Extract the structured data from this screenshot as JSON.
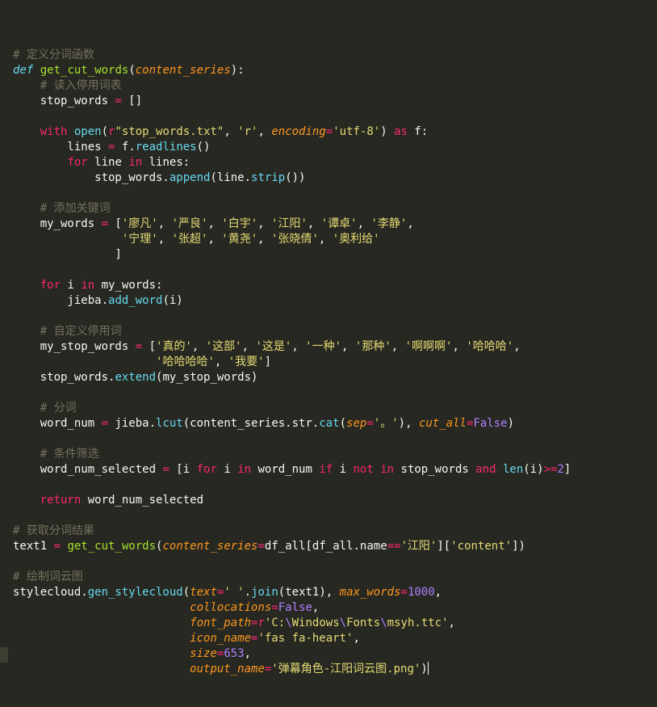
{
  "editor": {
    "lines": [
      [],
      [
        [
          "c-com",
          "# 定义分词函数"
        ]
      ],
      [
        [
          "c-def",
          "def"
        ],
        [
          "c-txt",
          " "
        ],
        [
          "c-fn",
          "get_cut_words"
        ],
        [
          "c-txt",
          "("
        ],
        [
          "c-prm",
          "content_series"
        ],
        [
          "c-txt",
          "):"
        ]
      ],
      [
        [
          "c-txt",
          "    "
        ],
        [
          "c-com",
          "# 读入停用词表"
        ]
      ],
      [
        [
          "c-txt",
          "    stop_words "
        ],
        [
          "c-kw",
          "="
        ],
        [
          "c-txt",
          " []"
        ]
      ],
      [],
      [
        [
          "c-txt",
          "    "
        ],
        [
          "c-kw",
          "with"
        ],
        [
          "c-txt",
          " "
        ],
        [
          "c-bi",
          "open"
        ],
        [
          "c-txt",
          "("
        ],
        [
          "c-kw",
          "r"
        ],
        [
          "c-str",
          "\"stop_words.txt\""
        ],
        [
          "c-txt",
          ", "
        ],
        [
          "c-str",
          "'r'"
        ],
        [
          "c-txt",
          ", "
        ],
        [
          "c-prm",
          "encoding"
        ],
        [
          "c-kw",
          "="
        ],
        [
          "c-str",
          "'utf-8'"
        ],
        [
          "c-txt",
          ") "
        ],
        [
          "c-kw",
          "as"
        ],
        [
          "c-txt",
          " f:"
        ]
      ],
      [
        [
          "c-txt",
          "        lines "
        ],
        [
          "c-kw",
          "="
        ],
        [
          "c-txt",
          " f."
        ],
        [
          "c-bi",
          "readlines"
        ],
        [
          "c-txt",
          "()"
        ]
      ],
      [
        [
          "c-txt",
          "        "
        ],
        [
          "c-kw",
          "for"
        ],
        [
          "c-txt",
          " line "
        ],
        [
          "c-kw",
          "in"
        ],
        [
          "c-txt",
          " lines:"
        ]
      ],
      [
        [
          "c-txt",
          "            stop_words."
        ],
        [
          "c-bi",
          "append"
        ],
        [
          "c-txt",
          "(line."
        ],
        [
          "c-bi",
          "strip"
        ],
        [
          "c-txt",
          "())"
        ]
      ],
      [],
      [
        [
          "c-txt",
          "    "
        ],
        [
          "c-com",
          "# 添加关键词"
        ]
      ],
      [
        [
          "c-txt",
          "    my_words "
        ],
        [
          "c-kw",
          "="
        ],
        [
          "c-txt",
          " ["
        ],
        [
          "c-str",
          "'廖凡'"
        ],
        [
          "c-txt",
          ", "
        ],
        [
          "c-str",
          "'严良'"
        ],
        [
          "c-txt",
          ", "
        ],
        [
          "c-str",
          "'白宇'"
        ],
        [
          "c-txt",
          ", "
        ],
        [
          "c-str",
          "'江阳'"
        ],
        [
          "c-txt",
          ", "
        ],
        [
          "c-str",
          "'谭卓'"
        ],
        [
          "c-txt",
          ", "
        ],
        [
          "c-str",
          "'李静'"
        ],
        [
          "c-txt",
          ","
        ]
      ],
      [
        [
          "c-txt",
          "                "
        ],
        [
          "c-str",
          "'宁理'"
        ],
        [
          "c-txt",
          ", "
        ],
        [
          "c-str",
          "'张超'"
        ],
        [
          "c-txt",
          ", "
        ],
        [
          "c-str",
          "'黄尧'"
        ],
        [
          "c-txt",
          ", "
        ],
        [
          "c-str",
          "'张晓倩'"
        ],
        [
          "c-txt",
          ", "
        ],
        [
          "c-str",
          "'奥利给'"
        ]
      ],
      [
        [
          "c-txt",
          "               ]"
        ]
      ],
      [],
      [
        [
          "c-txt",
          "    "
        ],
        [
          "c-kw",
          "for"
        ],
        [
          "c-txt",
          " i "
        ],
        [
          "c-kw",
          "in"
        ],
        [
          "c-txt",
          " my_words:"
        ]
      ],
      [
        [
          "c-txt",
          "        jieba."
        ],
        [
          "c-bi",
          "add_word"
        ],
        [
          "c-txt",
          "(i)"
        ]
      ],
      [],
      [
        [
          "c-txt",
          "    "
        ],
        [
          "c-com",
          "# 自定义停用词"
        ]
      ],
      [
        [
          "c-txt",
          "    my_stop_words "
        ],
        [
          "c-kw",
          "="
        ],
        [
          "c-txt",
          " ["
        ],
        [
          "c-str",
          "'真的'"
        ],
        [
          "c-txt",
          ", "
        ],
        [
          "c-str",
          "'这部'"
        ],
        [
          "c-txt",
          ", "
        ],
        [
          "c-str",
          "'这是'"
        ],
        [
          "c-txt",
          ", "
        ],
        [
          "c-str",
          "'一种'"
        ],
        [
          "c-txt",
          ", "
        ],
        [
          "c-str",
          "'那种'"
        ],
        [
          "c-txt",
          ", "
        ],
        [
          "c-str",
          "'啊啊啊'"
        ],
        [
          "c-txt",
          ", "
        ],
        [
          "c-str",
          "'哈哈哈'"
        ],
        [
          "c-txt",
          ","
        ]
      ],
      [
        [
          "c-txt",
          "                     "
        ],
        [
          "c-str",
          "'哈哈哈哈'"
        ],
        [
          "c-txt",
          ", "
        ],
        [
          "c-str",
          "'我要'"
        ],
        [
          "c-txt",
          "]"
        ]
      ],
      [
        [
          "c-txt",
          "    stop_words."
        ],
        [
          "c-bi",
          "extend"
        ],
        [
          "c-txt",
          "(my_stop_words)"
        ]
      ],
      [],
      [
        [
          "c-txt",
          "    "
        ],
        [
          "c-com",
          "# 分词"
        ]
      ],
      [
        [
          "c-txt",
          "    word_num "
        ],
        [
          "c-kw",
          "="
        ],
        [
          "c-txt",
          " jieba."
        ],
        [
          "c-bi",
          "lcut"
        ],
        [
          "c-txt",
          "(content_series.str."
        ],
        [
          "c-bi",
          "cat"
        ],
        [
          "c-txt",
          "("
        ],
        [
          "c-prm",
          "sep"
        ],
        [
          "c-kw",
          "="
        ],
        [
          "c-str",
          "'。'"
        ],
        [
          "c-txt",
          "), "
        ],
        [
          "c-prm",
          "cut_all"
        ],
        [
          "c-kw",
          "="
        ],
        [
          "c-num",
          "False"
        ],
        [
          "c-txt",
          ")"
        ]
      ],
      [],
      [
        [
          "c-txt",
          "    "
        ],
        [
          "c-com",
          "# 条件筛选"
        ]
      ],
      [
        [
          "c-txt",
          "    word_num_selected "
        ],
        [
          "c-kw",
          "="
        ],
        [
          "c-txt",
          " [i "
        ],
        [
          "c-kw",
          "for"
        ],
        [
          "c-txt",
          " i "
        ],
        [
          "c-kw",
          "in"
        ],
        [
          "c-txt",
          " word_num "
        ],
        [
          "c-kw",
          "if"
        ],
        [
          "c-txt",
          " i "
        ],
        [
          "c-kw",
          "not"
        ],
        [
          "c-txt",
          " "
        ],
        [
          "c-kw",
          "in"
        ],
        [
          "c-txt",
          " stop_words "
        ],
        [
          "c-kw",
          "and"
        ],
        [
          "c-txt",
          " "
        ],
        [
          "c-bi",
          "len"
        ],
        [
          "c-txt",
          "(i)"
        ],
        [
          "c-kw",
          ">="
        ],
        [
          "c-num",
          "2"
        ],
        [
          "c-txt",
          "]"
        ]
      ],
      [],
      [
        [
          "c-txt",
          "    "
        ],
        [
          "c-kw",
          "return"
        ],
        [
          "c-txt",
          " word_num_selected"
        ]
      ],
      [],
      [
        [
          "c-com",
          "# 获取分词结果"
        ]
      ],
      [
        [
          "c-txt",
          "text1 "
        ],
        [
          "c-kw",
          "="
        ],
        [
          "c-txt",
          " "
        ],
        [
          "c-fn",
          "get_cut_words"
        ],
        [
          "c-txt",
          "("
        ],
        [
          "c-prm",
          "content_series"
        ],
        [
          "c-kw",
          "="
        ],
        [
          "c-txt",
          "df_all[df_all.name"
        ],
        [
          "c-kw",
          "=="
        ],
        [
          "c-str",
          "'江阳'"
        ],
        [
          "c-txt",
          "]["
        ],
        [
          "c-str",
          "'content'"
        ],
        [
          "c-txt",
          "])"
        ]
      ],
      [],
      [
        [
          "c-com",
          "# 绘制词云图"
        ]
      ],
      [
        [
          "c-txt",
          "stylecloud."
        ],
        [
          "c-bi",
          "gen_stylecloud"
        ],
        [
          "c-txt",
          "("
        ],
        [
          "c-prm",
          "text"
        ],
        [
          "c-kw",
          "="
        ],
        [
          "c-str",
          "' '"
        ],
        [
          "c-txt",
          "."
        ],
        [
          "c-bi",
          "join"
        ],
        [
          "c-txt",
          "(text1), "
        ],
        [
          "c-prm",
          "max_words"
        ],
        [
          "c-kw",
          "="
        ],
        [
          "c-num",
          "1000"
        ],
        [
          "c-txt",
          ","
        ]
      ],
      [
        [
          "c-txt",
          "                          "
        ],
        [
          "c-prm",
          "collocations"
        ],
        [
          "c-kw",
          "="
        ],
        [
          "c-num",
          "False"
        ],
        [
          "c-txt",
          ","
        ]
      ],
      [
        [
          "c-txt",
          "                          "
        ],
        [
          "c-prm",
          "font_path"
        ],
        [
          "c-kw",
          "="
        ],
        [
          "c-kw",
          "r"
        ],
        [
          "c-str",
          "'C:"
        ],
        [
          "c-esc",
          "\\"
        ],
        [
          "c-str",
          "Windows"
        ],
        [
          "c-esc",
          "\\"
        ],
        [
          "c-str",
          "Fonts"
        ],
        [
          "c-esc",
          "\\"
        ],
        [
          "c-str",
          "msyh.ttc'"
        ],
        [
          "c-txt",
          ","
        ]
      ],
      [
        [
          "c-txt",
          "                          "
        ],
        [
          "c-prm",
          "icon_name"
        ],
        [
          "c-kw",
          "="
        ],
        [
          "c-str",
          "'fas fa-heart'"
        ],
        [
          "c-txt",
          ","
        ]
      ],
      [
        [
          "c-txt",
          "                          "
        ],
        [
          "c-prm",
          "size"
        ],
        [
          "c-kw",
          "="
        ],
        [
          "c-num",
          "653"
        ],
        [
          "c-txt",
          ","
        ]
      ],
      [
        [
          "c-txt",
          "                          "
        ],
        [
          "c-prm",
          "output_name"
        ],
        [
          "c-kw",
          "="
        ],
        [
          "c-str",
          "'弹幕角色-江阳词云图.png'"
        ],
        [
          "c-txt",
          ")"
        ]
      ]
    ],
    "cursor_line": 41
  }
}
